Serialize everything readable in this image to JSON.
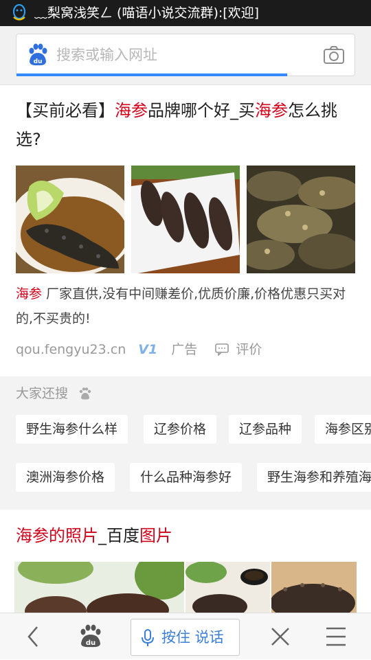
{
  "status_bar": {
    "notification_text": "﹏梨窝浅笑ㄥ (喵语小说交流群):[欢迎]"
  },
  "search": {
    "placeholder": "搜索或输入网址",
    "progress_percent": 80
  },
  "result": {
    "title_parts": [
      "【买前必看】",
      "海参",
      "品牌哪个好_买",
      "海参",
      "怎么挑选?"
    ],
    "description_keyword": "海参",
    "description": " 厂家直供,没有中间赚差价,优质价廉,价格优惠只买对的,不买贵的!",
    "url": "qou.fengyu23.cn",
    "badge": "V1",
    "ad_label": "广告",
    "review_label": "评价"
  },
  "related_searches": {
    "heading": "大家还搜",
    "items": [
      "野生海参什么样",
      "辽参价格",
      "辽参品种",
      "海参区别",
      "澳洲海参价格",
      "什么品种海参好",
      "野生海参和养殖海参"
    ]
  },
  "image_result": {
    "title_parts": [
      "海参的照片",
      "_百度",
      "图片"
    ]
  },
  "bottom_bar": {
    "voice_label": "按住 说话"
  },
  "colors": {
    "accent_blue": "#3388ff",
    "highlight_red": "#d0021b"
  }
}
